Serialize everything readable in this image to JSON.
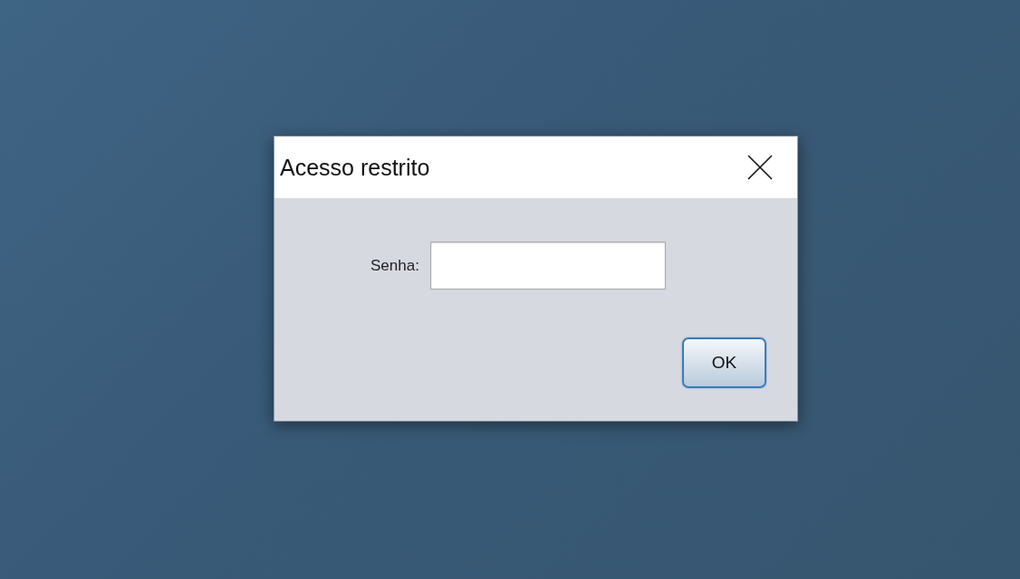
{
  "dialog": {
    "title": "Acesso restrito"
  },
  "field": {
    "label": "Senha:"
  },
  "buttons": [
    {
      "label": "OK",
      "focused": true
    }
  ]
}
